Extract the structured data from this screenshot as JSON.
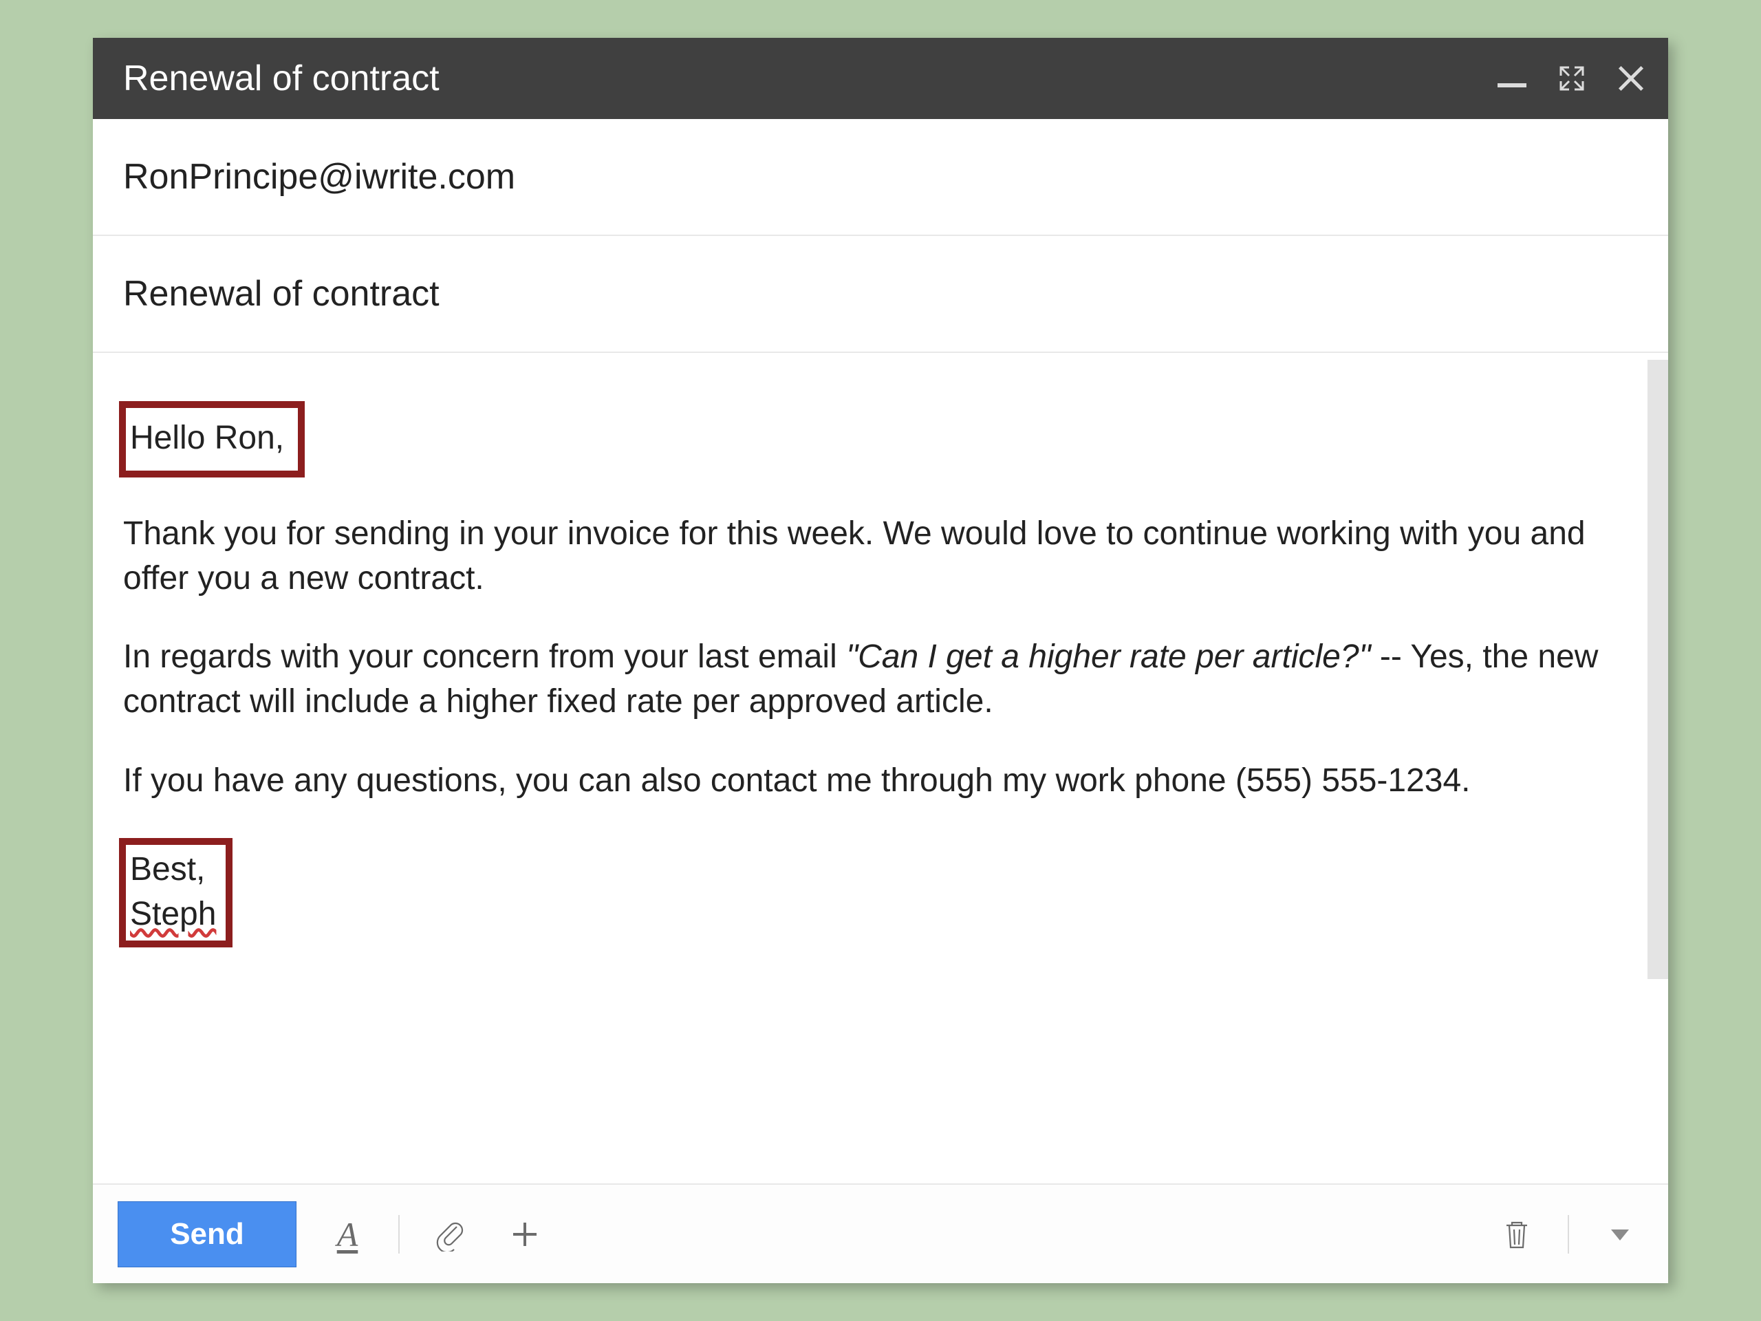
{
  "window": {
    "title": "Renewal of contract"
  },
  "compose": {
    "to": "RonPrincipe@iwrite.com",
    "subject": "Renewal of contract",
    "body": {
      "greeting": "Hello Ron,",
      "para1": "Thank you for sending in your invoice for this week. We would love to continue working with you and offer you a new contract.",
      "para2_pre": "In regards with your concern from your last email ",
      "para2_quote": "\"Can I get a higher rate per article?\"",
      "para2_post": " -- Yes, the new contract will include a higher fixed rate per approved article.",
      "para3": "If you have any questions, you can also contact me through my work phone (555) 555-1234.",
      "signoff": "Best,",
      "signature": "Steph"
    }
  },
  "footer": {
    "send_label": "Send"
  },
  "icons": {
    "minimize": "minimize-icon",
    "expand": "expand-icon",
    "close": "close-icon",
    "format": "format-icon",
    "attach": "attach-icon",
    "insert": "plus-icon",
    "trash": "trash-icon",
    "more": "more-menu-icon"
  },
  "annotations": {
    "greeting_boxed": true,
    "signature_boxed": true,
    "box_color": "#8c1e1e"
  }
}
